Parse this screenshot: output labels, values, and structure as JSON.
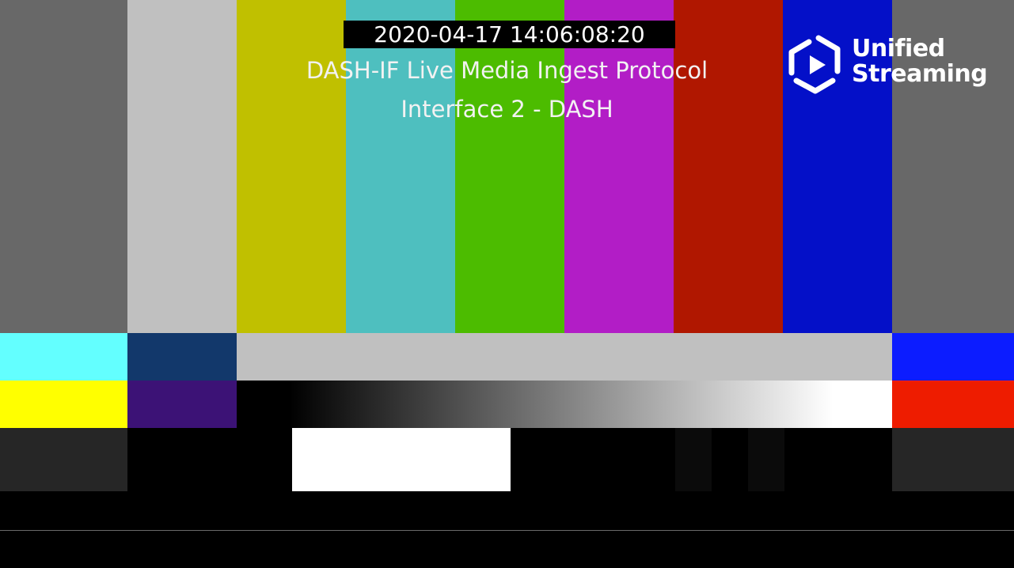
{
  "overlay": {
    "timecode": "2020-04-17 14:06:08:20",
    "caption_line_1": "DASH-IF Live Media Ingest Protocol",
    "caption_line_2": "Interface 2 - DASH"
  },
  "logo": {
    "line_1": "Unified",
    "line_2": "Streaming",
    "icon": "hexagon-play-icon"
  },
  "colors": {
    "gray": "#686868",
    "white": "#c0c0c0",
    "yellow": "#c0c000",
    "cyan": "#4ebfbf",
    "green": "#4cbc00",
    "magenta": "#b21dc6",
    "red": "#b01700",
    "blue": "#0410c8"
  }
}
